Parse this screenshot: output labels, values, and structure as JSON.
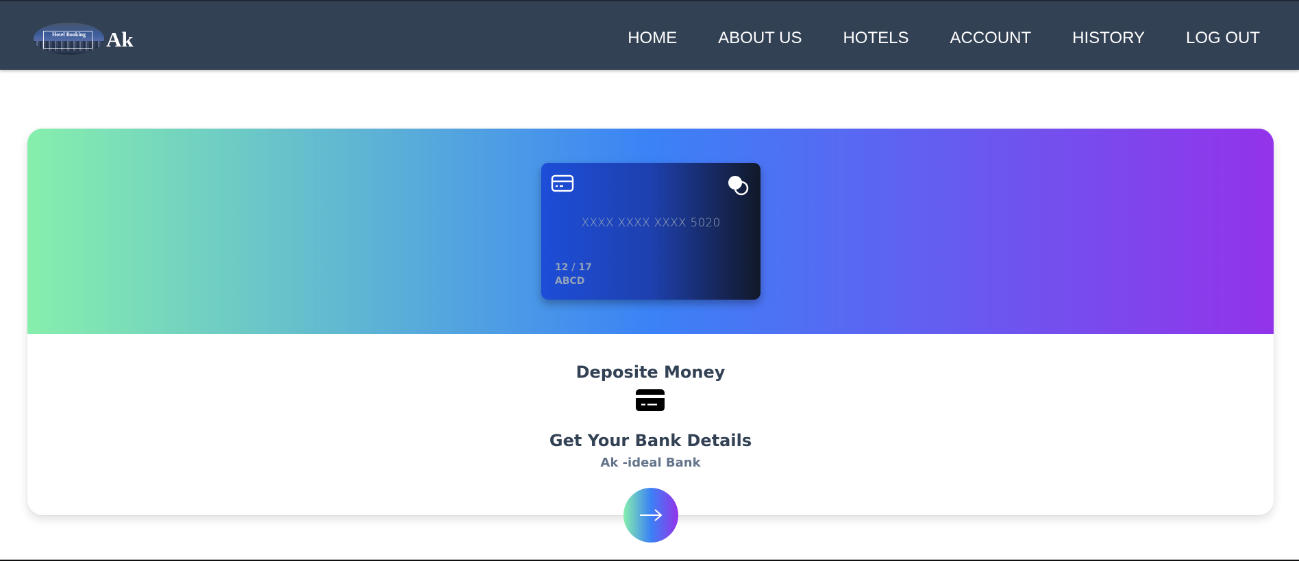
{
  "header": {
    "logo_text": "Hotel Booking",
    "brand": "Ak",
    "nav": [
      {
        "label": "HOME"
      },
      {
        "label": "ABOUT US"
      },
      {
        "label": "HOTELS"
      },
      {
        "label": "ACCOUNT"
      },
      {
        "label": "HISTORY"
      },
      {
        "label": "LOG OUT"
      }
    ],
    "background_color": "#334155"
  },
  "card": {
    "number": "XXXX XXXX XXXX 5020",
    "expiry": "12 / 17",
    "holder": "ABCD",
    "icons": [
      "credit-card-outline-icon",
      "toggle-circles-icon"
    ]
  },
  "hero": {
    "gradient": [
      "#86efac",
      "#3b82f6",
      "#9333ea"
    ]
  },
  "content": {
    "deposit_title": "Deposite Money",
    "deposit_icon": "credit-card-solid-icon",
    "bank_title": "Get Your Bank Details",
    "bank_name": "Ak -ideal Bank",
    "next_icon": "arrow-right-icon"
  }
}
